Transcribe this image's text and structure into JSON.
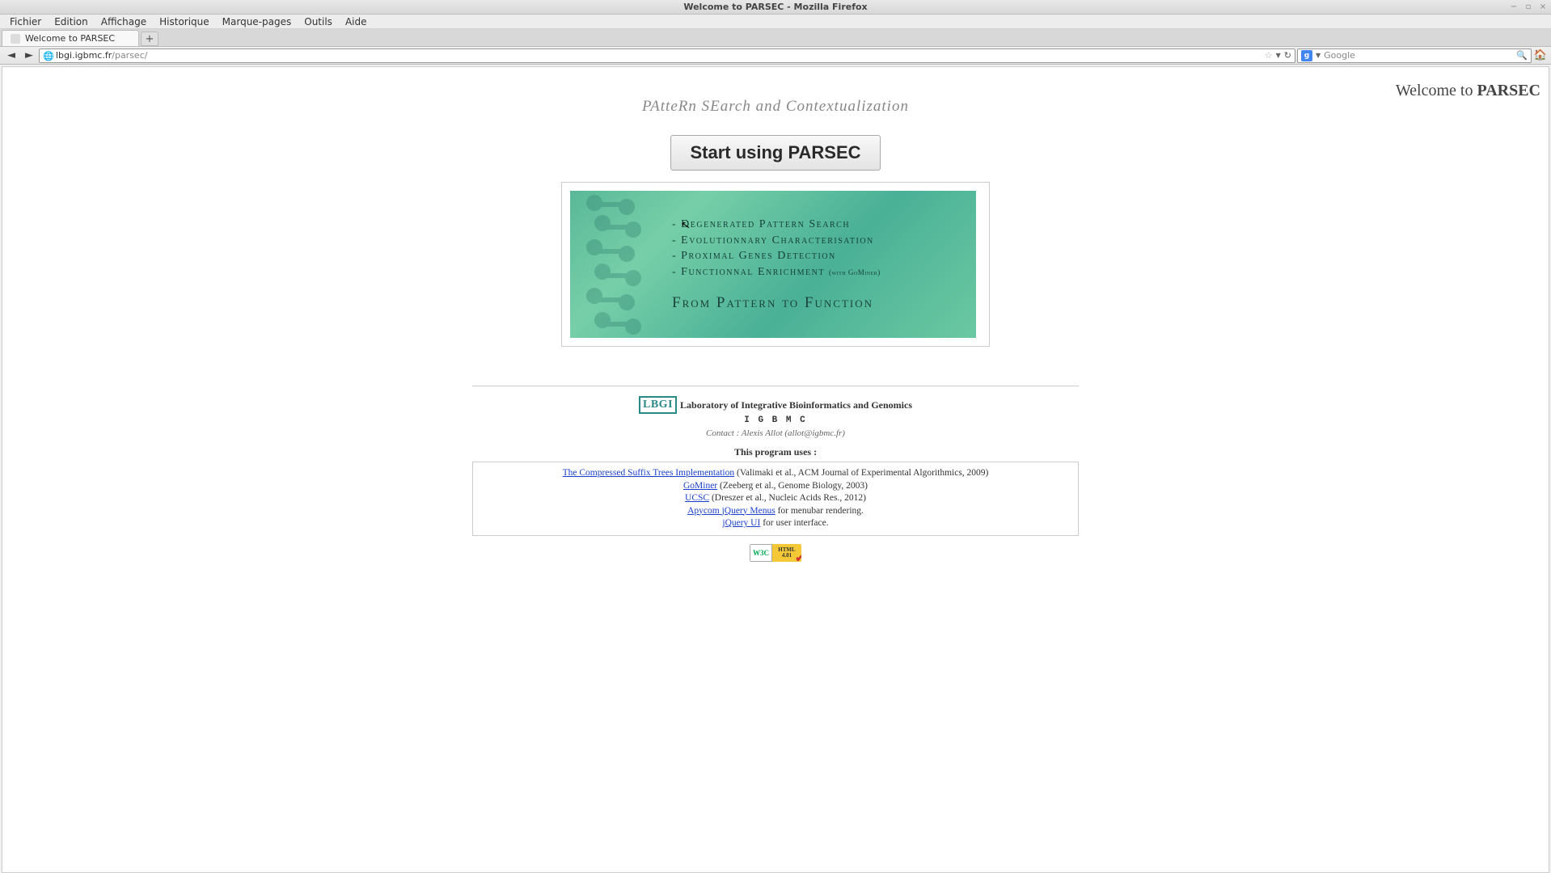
{
  "window": {
    "title": "Welcome to PARSEC - Mozilla Firefox"
  },
  "menubar": [
    "Fichier",
    "Edition",
    "Affichage",
    "Historique",
    "Marque-pages",
    "Outils",
    "Aide"
  ],
  "tab": {
    "title": "Welcome to PARSEC"
  },
  "urlbar": {
    "domain": "lbgi.igbmc.fr",
    "path": "/parsec/"
  },
  "search": {
    "engine_letter": "g",
    "placeholder": "Google"
  },
  "page": {
    "welcome_prefix": "Welcome to ",
    "welcome_name": "PARSEC",
    "tagline": "PAtteRn SEarch and Contextualization",
    "start_button": "Start using PARSEC",
    "banner": {
      "items": [
        "- Degenerated Pattern Search",
        "- Evolutionnary Characterisation",
        "- Proximal Genes Detection",
        "- Functionnal Enrichment"
      ],
      "gominer": "(with GoMiner)",
      "motto": "From Pattern to Function"
    },
    "footer": {
      "lbgi": "LBGI",
      "lab": "Laboratory of Integrative Bioinformatics and Genomics",
      "igbmc": "I G B M C",
      "contact": "Contact : Alexis Allot (allot@igbmc.fr)",
      "uses_label": "This program uses :",
      "credits": [
        {
          "link": "The Compressed Suffix Trees Implementation",
          "rest": " (Valimaki et al., ACM Journal of Experimental Algorithmics, 2009)"
        },
        {
          "link": "GoMiner",
          "rest": " (Zeeberg et al., Genome Biology, 2003)"
        },
        {
          "link": "UCSC",
          "rest": " (Dreszer et al., Nucleic Acids Res., 2012)"
        },
        {
          "link": "Apycom jQuery Menus",
          "rest": " for menubar rendering."
        },
        {
          "link": "jQuery UI",
          "rest": " for user interface."
        }
      ],
      "w3c_left": "W3C",
      "w3c_right": "HTML 4.01"
    }
  }
}
